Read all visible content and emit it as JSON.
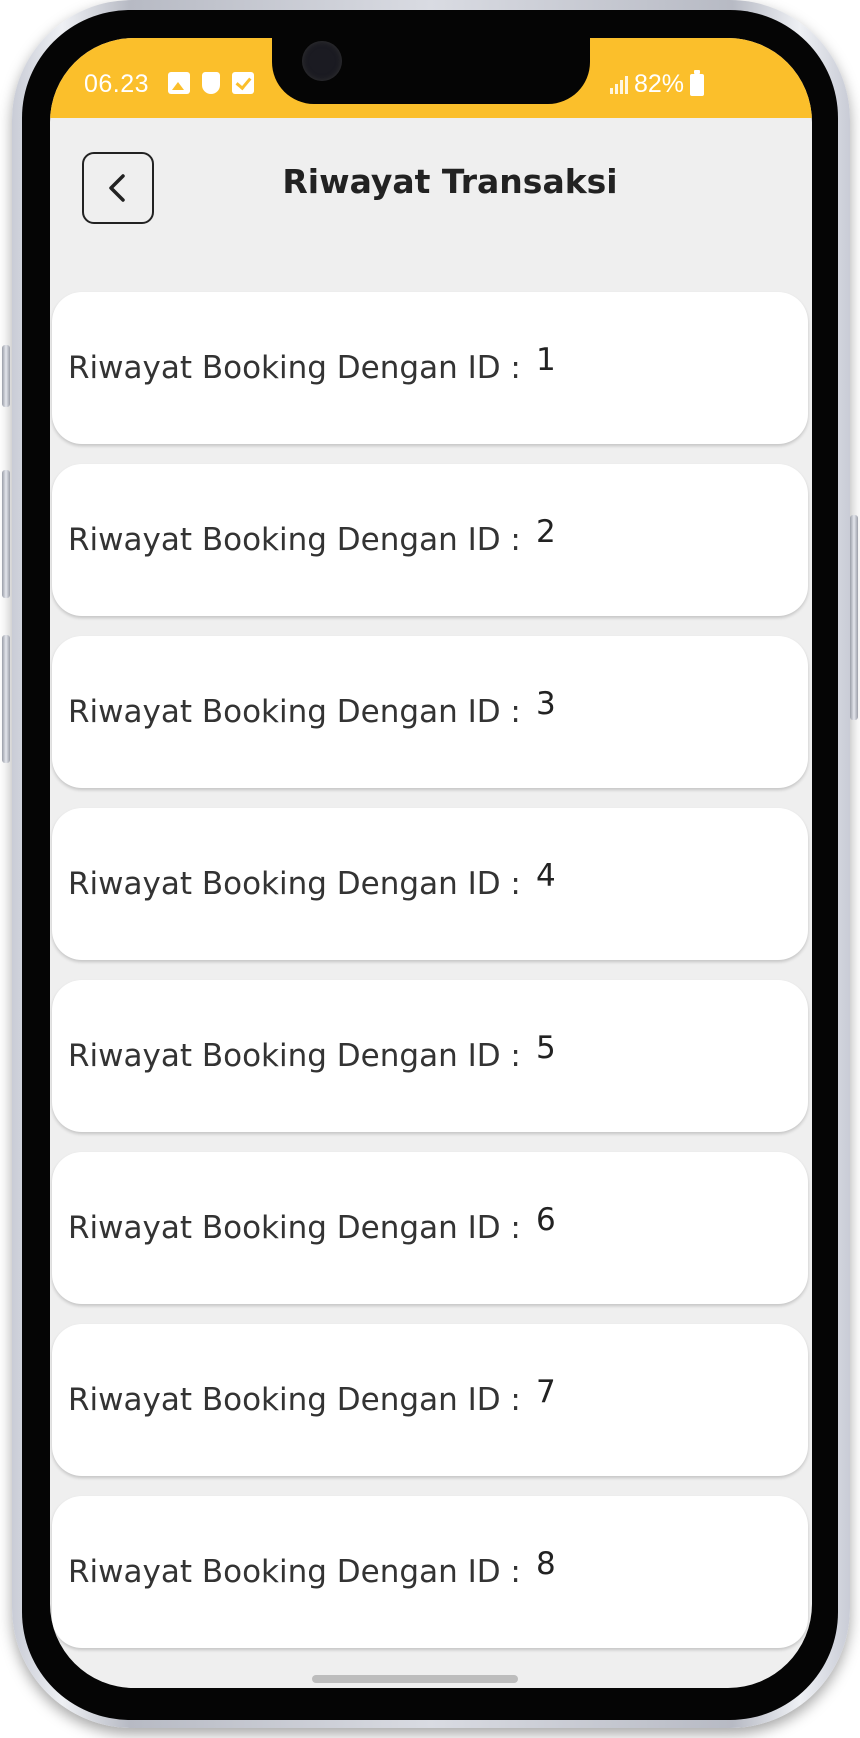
{
  "status_bar": {
    "time": "06.23",
    "battery": "82%",
    "color": "#fbbf2b",
    "icons": [
      "image-icon",
      "shield-icon",
      "check-icon",
      "signal-icon",
      "battery-icon"
    ]
  },
  "header": {
    "title": "Riwayat Transaksi",
    "back_icon": "chevron-left-icon"
  },
  "transactions": [
    {
      "label": "Riwayat Booking Dengan ID :",
      "id": "1"
    },
    {
      "label": "Riwayat Booking Dengan ID :",
      "id": "2"
    },
    {
      "label": "Riwayat Booking Dengan ID :",
      "id": "3"
    },
    {
      "label": "Riwayat Booking Dengan ID :",
      "id": "4"
    },
    {
      "label": "Riwayat Booking Dengan ID :",
      "id": "5"
    },
    {
      "label": "Riwayat Booking Dengan ID :",
      "id": "6"
    },
    {
      "label": "Riwayat Booking Dengan ID :",
      "id": "7"
    },
    {
      "label": "Riwayat Booking Dengan ID :",
      "id": "8"
    }
  ],
  "colors": {
    "accent": "#fbbf2b",
    "background": "#efefef",
    "card": "#ffffff"
  }
}
